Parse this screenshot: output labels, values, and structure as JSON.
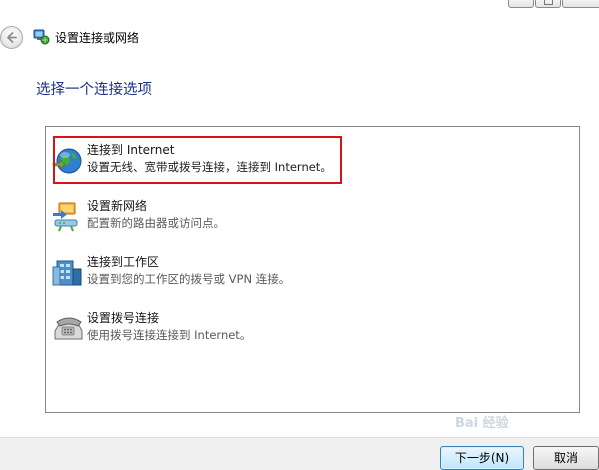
{
  "window": {
    "title": "设置连接或网络"
  },
  "heading": "选择一个连接选项",
  "options": [
    {
      "title": "连接到 Internet",
      "desc": "设置无线、宽带或拨号连接，连接到 Internet。",
      "icon": "globe-network-icon"
    },
    {
      "title": "设置新网络",
      "desc": "配置新的路由器或访问点。",
      "icon": "router-network-icon"
    },
    {
      "title": "连接到工作区",
      "desc": "设置到您的工作区的拨号或 VPN 连接。",
      "icon": "workplace-vpn-icon"
    },
    {
      "title": "设置拨号连接",
      "desc": "使用拨号连接连接到 Internet。",
      "icon": "dialup-phone-icon"
    }
  ],
  "buttons": {
    "next": "下一步(N)",
    "cancel": "取消"
  },
  "watermark": "Bai 经验",
  "colors": {
    "heading": "#1e3287",
    "highlight_border": "#d3141b"
  }
}
